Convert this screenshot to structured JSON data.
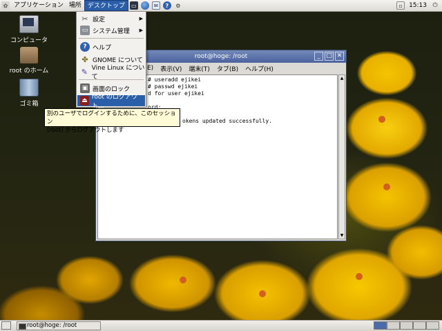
{
  "top_panel": {
    "applications_label": "アプリケーション",
    "places_label": "場所",
    "desktop_label": "デスクトップ",
    "clock": "15:13"
  },
  "desktop_icons": [
    {
      "label": "コンピュータ",
      "icon": "computer-icon"
    },
    {
      "label": "root のホーム",
      "icon": "home-folder-icon"
    },
    {
      "label": "ゴミ箱",
      "icon": "trash-icon"
    }
  ],
  "desktop_menu": {
    "items": [
      {
        "label": "設定",
        "icon": "settings-icon",
        "submenu": true
      },
      {
        "label": "システム管理",
        "icon": "system-admin-icon",
        "submenu": true
      },
      {
        "label": "ヘルプ",
        "icon": "help-icon"
      },
      {
        "label": "GNOME について",
        "icon": "gnome-icon"
      },
      {
        "label": "Vine Linux について",
        "icon": "vine-icon"
      },
      {
        "label": "画面のロック",
        "icon": "lock-screen-icon"
      },
      {
        "label": "root のログアウト...",
        "icon": "logout-icon"
      }
    ]
  },
  "tooltip": {
    "line1": "別のユーザでログインするために、このセッション",
    "line2": "(root) からログアウトします"
  },
  "terminal": {
    "title": "root@hoge: /root",
    "menus": [
      "表示(V)",
      "端末(T)",
      "タブ(B)",
      "ヘルプ(H)"
    ],
    "menu_partial": "E)",
    "lines": [
      "# useradd ejikei",
      "# passwd ejikei",
      "d for user ejikei",
      "",
      "ord:",
      "",
      "okens updated successfully.",
      ""
    ]
  },
  "taskbar": {
    "task_label": "root@hoge: /root"
  },
  "colors": {
    "selection": "#2b5ea8",
    "titlebar": "#5a70a8",
    "tooltip_bg": "#fffbd6"
  }
}
